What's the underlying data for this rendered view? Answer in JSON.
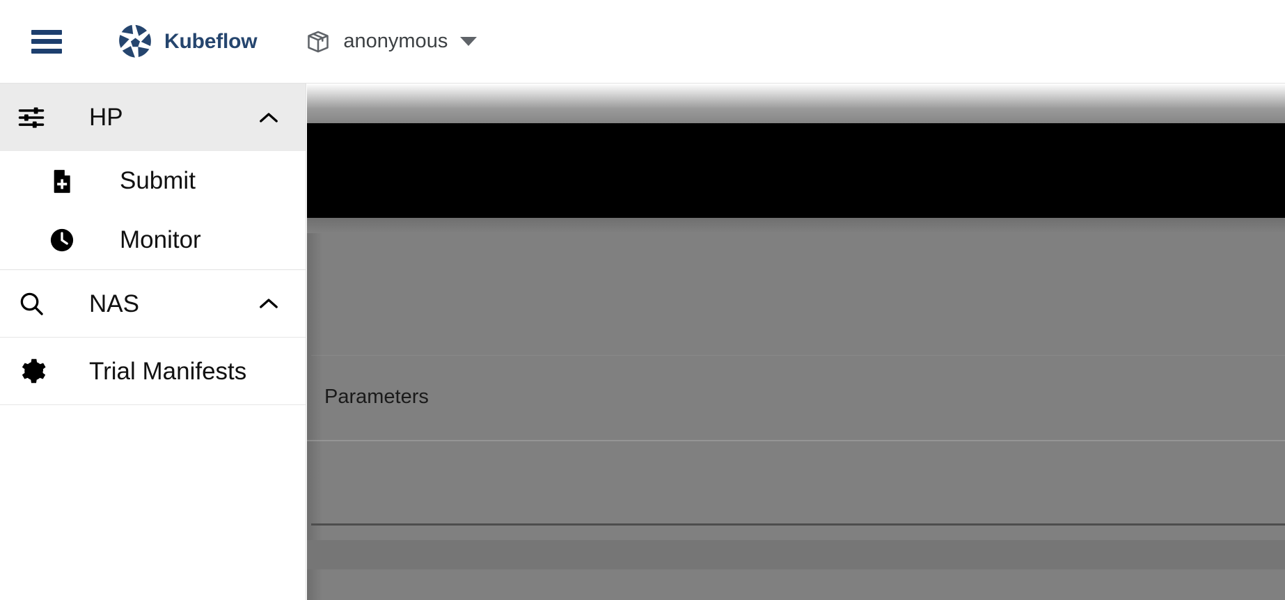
{
  "topbar": {
    "menu_icon": "hamburger-menu-icon",
    "brand": "Kubeflow",
    "brand_logo_icon": "kubeflow-logo-icon",
    "brand_color": "#25456e",
    "namespace_icon": "namespace-box-icon",
    "namespace": "anonymous",
    "namespace_caret_icon": "caret-down-icon"
  },
  "sidebar": {
    "groups": [
      {
        "label": "HP",
        "icon": "tune-sliders-icon",
        "expanded": true,
        "active": true,
        "chevron": "chevron-up-icon",
        "children": [
          {
            "label": "Submit",
            "icon": "file-add-icon"
          },
          {
            "label": "Monitor",
            "icon": "clock-icon"
          }
        ]
      },
      {
        "label": "NAS",
        "icon": "search-icon",
        "expanded": true,
        "active": false,
        "chevron": "chevron-up-icon",
        "children": []
      }
    ],
    "items": [
      {
        "label": "Trial Manifests",
        "icon": "gear-icon"
      }
    ]
  },
  "main": {
    "overlay_color": "#808080",
    "banner_color": "#000000",
    "section_label": "Parameters"
  }
}
